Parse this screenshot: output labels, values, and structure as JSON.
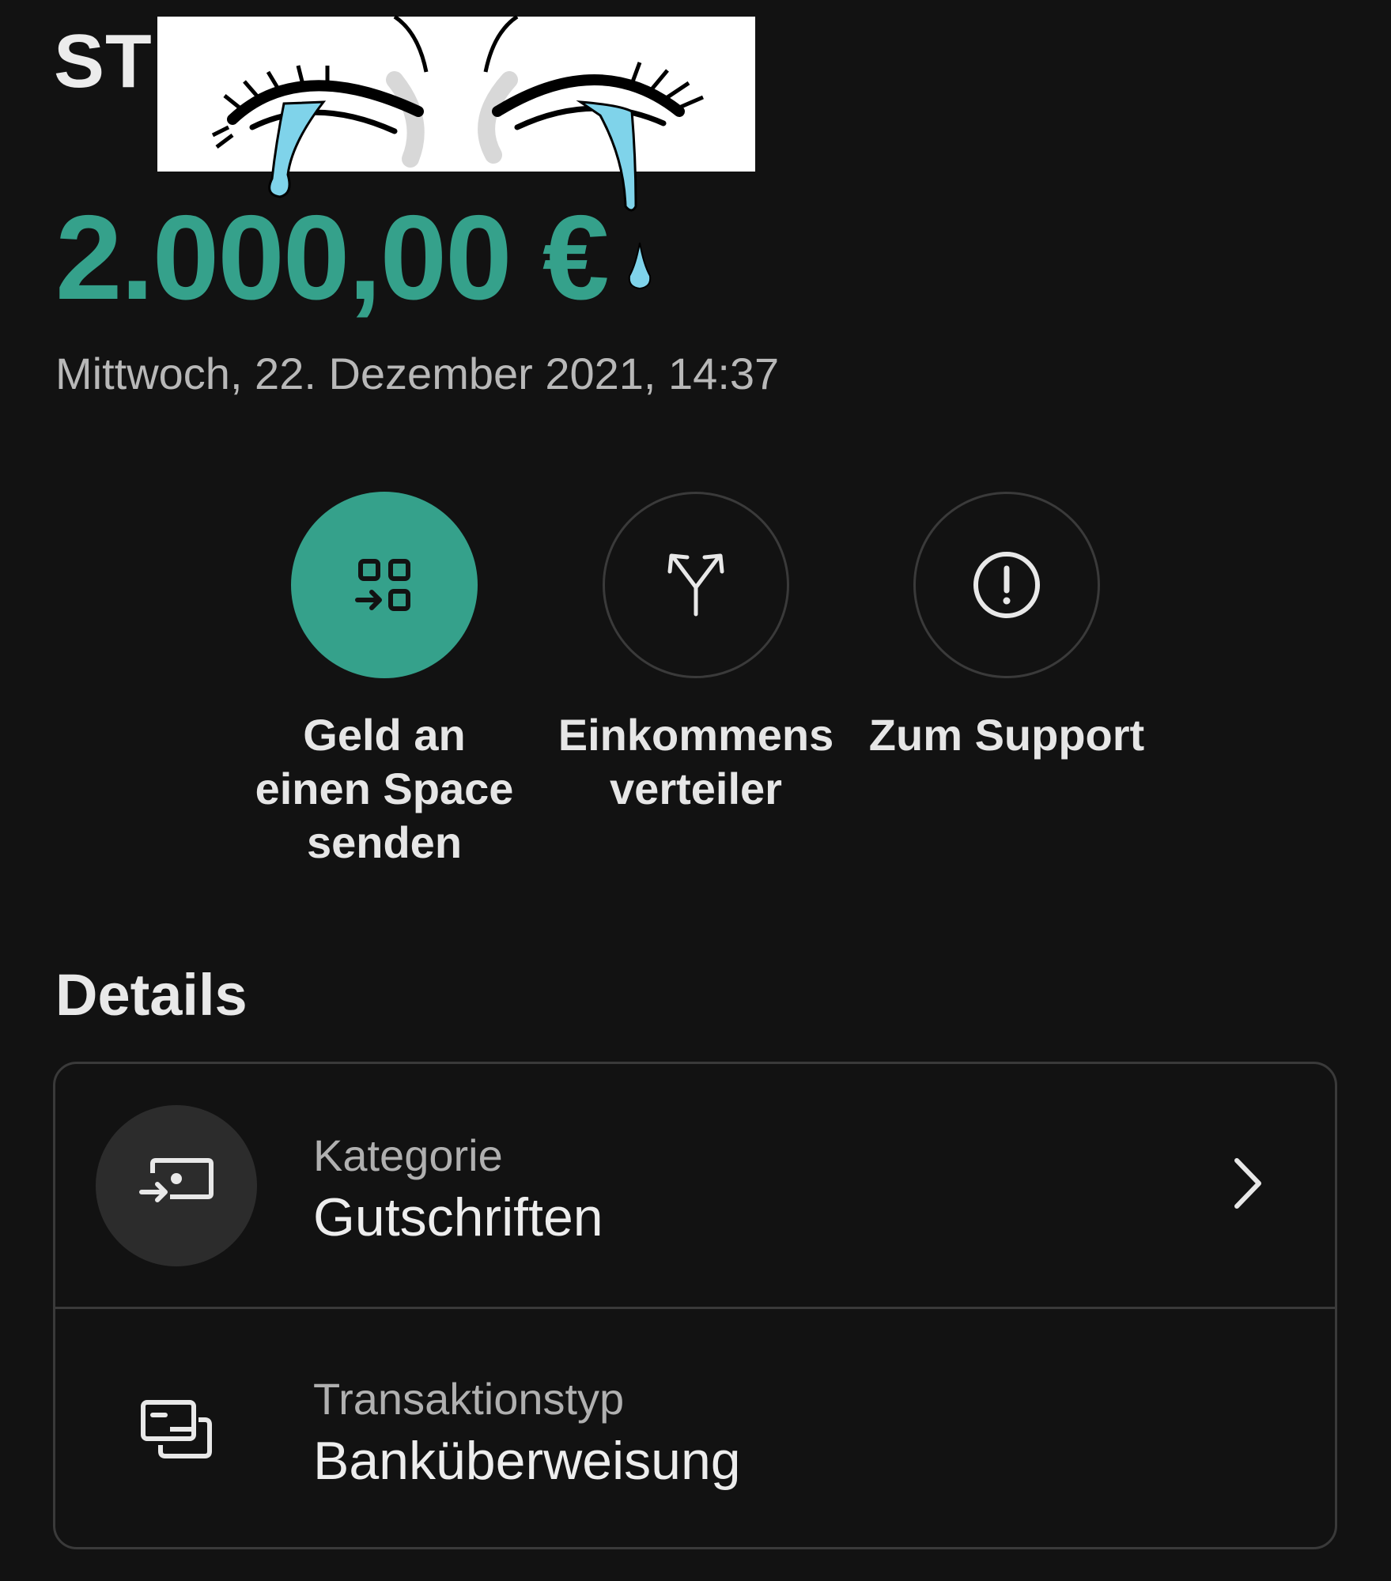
{
  "header": {
    "title": "ST"
  },
  "transaction": {
    "amount": "2.000,00 €",
    "datetime": "Mittwoch, 22. Dezember 2021, 14:37"
  },
  "colors": {
    "accent": "#35a18b",
    "background": "#121212"
  },
  "actions": [
    {
      "label": "Geld an\neinen Space\nsenden",
      "icon": "space-transfer-icon"
    },
    {
      "label": "Einkommens\nverteiler",
      "icon": "split-arrows-icon"
    },
    {
      "label": "Zum Support",
      "icon": "exclamation-circle-icon"
    }
  ],
  "details": {
    "heading": "Details",
    "rows": [
      {
        "label": "Kategorie",
        "value": "Gutschriften",
        "icon": "incoming-money-icon"
      },
      {
        "label": "Transaktionstyp",
        "value": "Banküberweisung",
        "icon": "cards-icon"
      }
    ]
  },
  "overlay": {
    "icon": "crying-eyes-sticker"
  }
}
